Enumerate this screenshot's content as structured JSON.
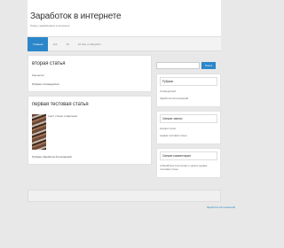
{
  "site": {
    "title": "Заработок в интернете",
    "description": "Помогу зарабатывать в интернете"
  },
  "nav": {
    "items": [
      "Главная",
      "123",
      "15",
      "К2 Site vs Blog/Info"
    ]
  },
  "posts": [
    {
      "title": "вторая статья",
      "text": "Контакты!",
      "meta_label": "Рубрика:",
      "meta_value": "Uncategorized"
    },
    {
      "title": "первая тестовая статья",
      "text": "текст статьи и картинка",
      "meta_label": "Рубрика:",
      "meta_value": "Заработок без вложений"
    }
  ],
  "search": {
    "placeholder": "",
    "button_label": "Поиск"
  },
  "widgets": [
    {
      "title": "Рубрики",
      "items": [
        "Uncategorized",
        "Заработок без вложений"
      ]
    },
    {
      "title": "Свежие записи",
      "items": [
        "вторая статья",
        "первая тестовая статья"
      ]
    },
    {
      "title": "Свежие комментарии",
      "items": [
        "A WordPress Commenter к записи первая тестовая статья"
      ]
    }
  ],
  "footer": {
    "text": "Заработок без вложений"
  },
  "colors": {
    "accent": "#2b87c9"
  }
}
